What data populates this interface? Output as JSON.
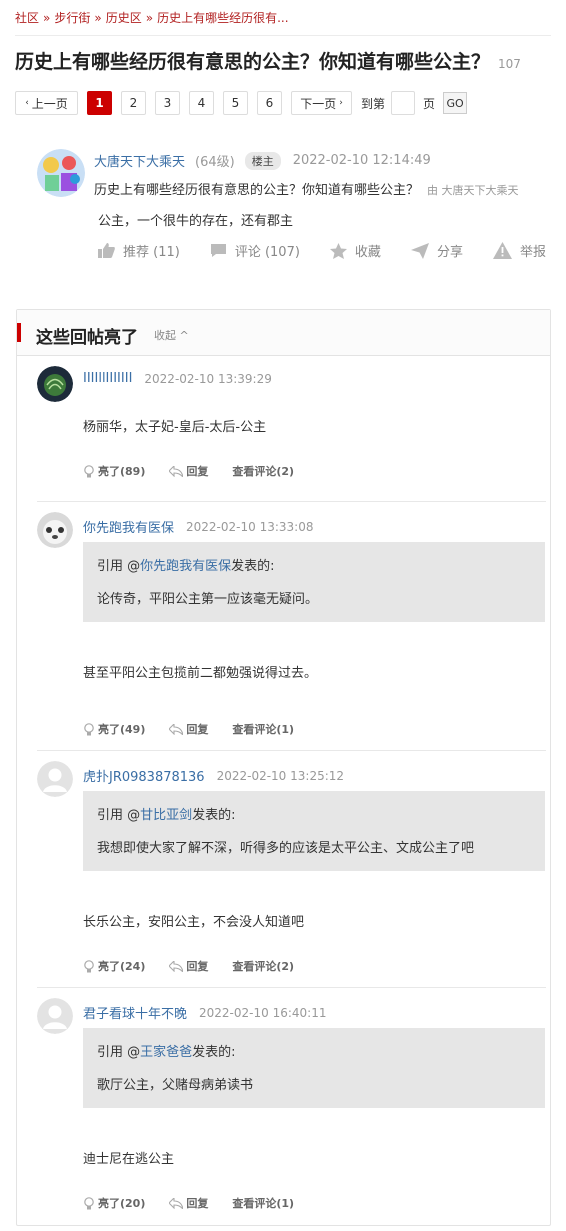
{
  "breadcrumb": [
    {
      "label": "社区"
    },
    {
      "label": "步行街"
    },
    {
      "label": "历史区"
    },
    {
      "label": "历史上有哪些经历很有..."
    }
  ],
  "breadcrumb_sep": "»",
  "title": "历史上有哪些经历很有意思的公主？你知道有哪些公主？",
  "title_count": "107",
  "pager": {
    "prev": "上一页",
    "pages": [
      "1",
      "2",
      "3",
      "4",
      "5",
      "6"
    ],
    "current": "1",
    "next": "下一页",
    "goto_prefix": "到第",
    "goto_suffix": "页",
    "go": "GO"
  },
  "op": {
    "author": "大唐天下大乘天",
    "level": "(64级)",
    "badge": "楼主",
    "time": "2022-02-10 12:14:49",
    "question": "历史上有哪些经历很有意思的公主？你知道有哪些公主？",
    "by": "由  大唐天下大乘天",
    "body": "公主，一个很牛的存在，还有郡主",
    "actions": {
      "recommend": "推荐 (11)",
      "comment": "评论 (107)",
      "favorite": "收藏",
      "share": "分享",
      "report": "举报"
    }
  },
  "highlights": {
    "title": "这些回帖亮了",
    "collapse": "收起"
  },
  "replies": [
    {
      "author": "IIIIllIIIIIII",
      "time": "2022-02-10 13:39:29",
      "quote": null,
      "text": "杨丽华，太子妃-皇后-太后-公主",
      "light": "亮了(89)",
      "reply": "回复",
      "comments": "查看评论(2)"
    },
    {
      "author": "你先跑我有医保",
      "time": "2022-02-10 13:33:08",
      "quote": {
        "prefix": "引用 @",
        "name": "你先跑我有医保",
        "suffix": "发表的:",
        "text": "论传奇，平阳公主第一应该毫无疑问。"
      },
      "text": "甚至平阳公主包揽前二都勉强说得过去。",
      "light": "亮了(49)",
      "reply": "回复",
      "comments": "查看评论(1)"
    },
    {
      "author": "虎扑JR0983878136",
      "time": "2022-02-10 13:25:12",
      "quote": {
        "prefix": "引用 @",
        "name": "甘比亚剑",
        "suffix": "发表的:",
        "text": "我想即使大家了解不深，听得多的应该是太平公主、文成公主了吧"
      },
      "text": "长乐公主，安阳公主，不会没人知道吧",
      "light": "亮了(24)",
      "reply": "回复",
      "comments": "查看评论(2)"
    },
    {
      "author": "君子看球十年不晚",
      "time": "2022-02-10 16:40:11",
      "quote": {
        "prefix": "引用 @",
        "name": "王家爸爸",
        "suffix": "发表的:",
        "text": "歌厅公主，父赌母病弟读书"
      },
      "text": "迪士尼在逃公主",
      "light": "亮了(20)",
      "reply": "回复",
      "comments": "查看评论(1)"
    }
  ],
  "colors": {
    "accent": "#cc0000",
    "link": "#3a6ea5",
    "quote_bg": "#e6e6e6"
  }
}
